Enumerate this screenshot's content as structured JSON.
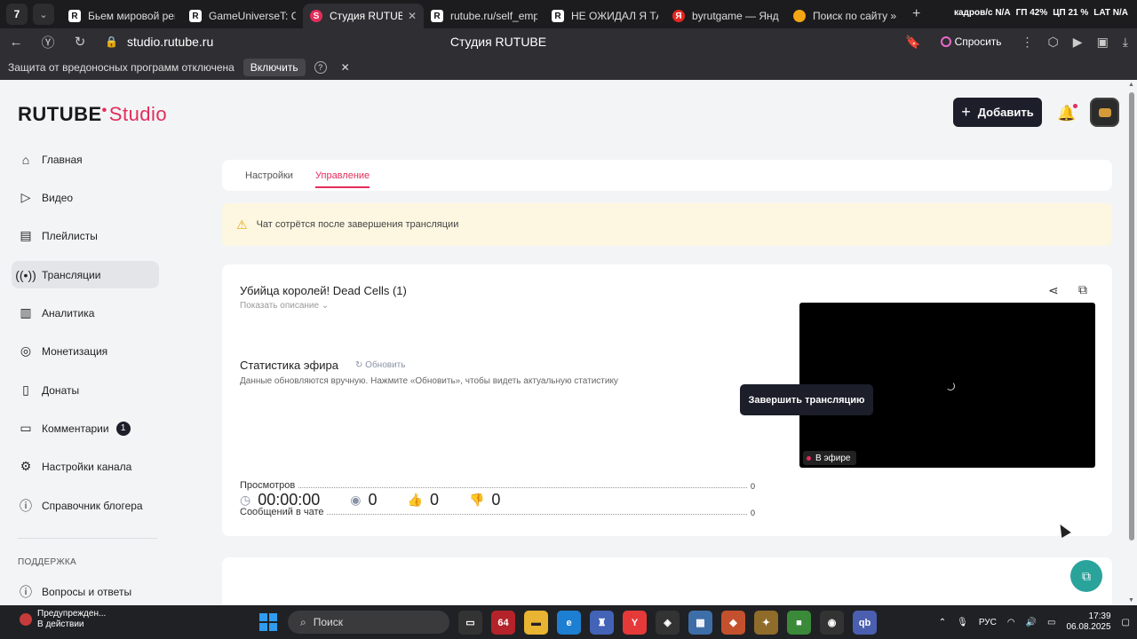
{
  "browser": {
    "app_badge": "7",
    "tabs": [
      {
        "label": "Бьем мировой реко",
        "fav": "R"
      },
      {
        "label": "GameUniverseT: Ск",
        "fav": "R"
      },
      {
        "label": "Студия RUTUBE",
        "fav": "S"
      },
      {
        "label": "rutube.ru/self_empl",
        "fav": "R"
      },
      {
        "label": "НЕ ОЖИДАЛ Я ТАК",
        "fav": "R"
      },
      {
        "label": "byrutgame — Яндек",
        "fav": "Я"
      },
      {
        "label": "Поиск по сайту » Ст",
        "fav": ""
      }
    ],
    "sys_stats": {
      "fps": "кадров/с N/A",
      "gpu": "ГП 42%",
      "cpu": "ЦП 21 %",
      "lat": "LAT N/A"
    },
    "url": "studio.rutube.ru",
    "page_title": "Студия RUTUBE",
    "ask_label": "Спросить",
    "infobar": {
      "text": "Защита от вредоносных программ отключена",
      "enable_label": "Включить",
      "help": "?",
      "close": "✕"
    }
  },
  "header": {
    "logo_text": "RUTUBE",
    "logo_studio": "Studio",
    "add_label": "Добавить"
  },
  "sidebar": {
    "items": [
      {
        "label": "Главная",
        "icon": "home-icon"
      },
      {
        "label": "Видео",
        "icon": "video-icon"
      },
      {
        "label": "Плейлисты",
        "icon": "playlist-icon"
      },
      {
        "label": "Трансляции",
        "icon": "broadcast-icon"
      },
      {
        "label": "Аналитика",
        "icon": "analytics-icon"
      },
      {
        "label": "Монетизация",
        "icon": "monetization-icon"
      },
      {
        "label": "Донаты",
        "icon": "donate-icon"
      },
      {
        "label": "Комментарии",
        "icon": "comments-icon",
        "badge": "1"
      },
      {
        "label": "Настройки канала",
        "icon": "gear-icon"
      },
      {
        "label": "Справочник блогера",
        "icon": "info-icon"
      }
    ],
    "support_heading": "ПОДДЕРЖКА",
    "faq_label": "Вопросы и ответы"
  },
  "page_tabs": {
    "settings": "Настройки",
    "management": "Управление"
  },
  "warning": {
    "text": "Чат сотрётся после завершения трансляции"
  },
  "stream": {
    "title": "Убийца королей! Dead Cells (1)",
    "show_description": "Показать описание",
    "stats_title": "Статистика эфира",
    "refresh_label": "Обновить",
    "stats_note": "Данные обновляются вручную. Нажмите «Обновить», чтобы видеть актуальную статистику",
    "stats": [
      {
        "label": "Просмотров",
        "value": "0"
      },
      {
        "label": "Сообщений в чате",
        "value": "0"
      }
    ],
    "live_label": "В эфире",
    "duration": "00:00:00",
    "viewers": "0",
    "likes": "0",
    "dislikes": "0",
    "end_label": "Завершить трансляцию"
  },
  "taskbar": {
    "notice_line1": "Предупрежден...",
    "notice_line2": "В действии",
    "search_placeholder": "Поиск",
    "pinned_badge": "64",
    "lang": "РУС",
    "time": "17:39",
    "date": "06.08.2025"
  }
}
